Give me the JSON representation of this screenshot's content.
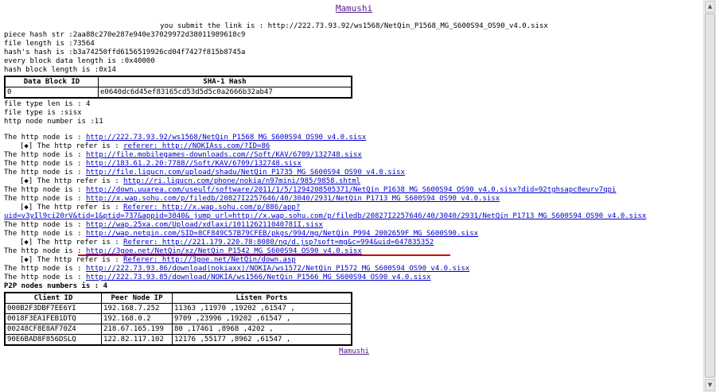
{
  "title_link": "Mamushi",
  "submit_line": "you submit the link is : http://222.73.93.92/ws1568/NetQin_P1568_MG_S600S94_OS90_v4.0.sisx",
  "info_lines": [
    "piece hash str :2aa88c270e287e940e37029972d38011989618c9",
    "file length is :73564",
    "hash's hash is :b3a74250ffd6156519926cd04f7427f815b8745a",
    "every block data length is :0x40000",
    "hash block length is :0x14"
  ],
  "block_table": {
    "headers": [
      "Data Block ID",
      "SHA-1 Hash"
    ],
    "rows": [
      [
        "0",
        "e0640dc6d45ef83165cd53d5d5c0a2666b32ab47"
      ]
    ]
  },
  "file_info": [
    "file type len is : 4",
    "file type is :sisx",
    "http node number is :11"
  ],
  "node_prefix": "The http node is : ",
  "refer_prefix": "[◆] The http refer is : ",
  "nodes": [
    {
      "url": "http://222.73.93.92/ws1568/NetQin_P1568_MG_S600S94_OS90_v4.0.sisx",
      "refer": "referer: http://NOKIAss.com/?ID=86 "
    },
    {
      "url": "http://file.mobilegames-downloads.com//Soft/KAV/6709/132748.sisx ",
      "refer": null
    },
    {
      "url": "http://183.61.2.20:7788//Soft/KAV/6709/132748.sisx ",
      "refer": null
    },
    {
      "url": "http://file.liqucn.com/upload/shadu/NetQin_P1735_MG_S600S94_OS90_v4.0.sisx ",
      "refer": "http://ri.liqucn.com/phone/nokia/n97mini/985/9858.shtml "
    },
    {
      "url": "http://down.uuarea.com/useulf/software/2011/1/5/1294208505371/NetQin_P1638_MG_S600S94_OS90_v4.0.sisx?did=92tghsapc8eurv7qpi ",
      "refer": null
    },
    {
      "url": "http://x.wap.sohu.com/p/filedb/20827I2257646/40/3040/2931/NetQin_P1713_MG_S600S94_OS90_v4.0.sisx ",
      "refer": "Referer: http://x.wap.sohu.com/p/886/app?",
      "refer_cont": "uid=v3yIl9ci20rV&tid=1&ptid=737&appid=3040&_jump_url=http://x.wap.sohu.com/p/filedb/20827I2257646/40/3040/2931/NetQin_P1713_MG_S600S94_OS90_v4.0.sisx "
    },
    {
      "url": "http://wap.25xa.com/Upload/xdlaxi/101126211040781I.sisx ",
      "refer": null
    },
    {
      "url": "http://wap.netqin.com/SID=8CF849C57B79CFEB/pkgs/994/mg/NetQin_P994_2002659F_MG_S600S90.sisx ",
      "refer": "Referer: http://221.179.220.78:8080/nq/d.jsp?soft=mg&c=994&uid=647835352 "
    },
    {
      "url": "http://3goe.net/NetQin/xz/NetQin_P1542_MG_S600S94_OS90_v4.0.sisx ",
      "refer": "Referer: http://3goe.net/NetQin/down.asp "
    },
    {
      "url": "http://222.73.93.86/download(nokiaxx)/NOKIA/ws1572/NetQin_P1572_MG_S600S94_OS90_v4.0.sisx ",
      "refer": null
    },
    {
      "url": "http://222.73.93.85/download/NOKIA/ws1566/NetQin_P1566_MG_S600S94_OS90_v4.0.sisx ",
      "refer": null
    }
  ],
  "p2p_heading": "P2P nodes numbers is : 4",
  "p2p_table": {
    "headers": [
      "Client ID",
      "Peer Node IP",
      "Listen Ports"
    ],
    "rows": [
      [
        "000B2F3DBF7EE6YI",
        "192.168.7.252",
        "11363 ,11970 ,19202 ,61547 ,"
      ],
      [
        "0018F3EA1FEB1DTQ",
        "192.168.0.2",
        "9709 ,23996 ,19202 ,61547 ,"
      ],
      [
        "00248CF8E8AF70Z4",
        "218.67.165.199",
        "80 ,17461 ,8968 ,4202 ,"
      ],
      [
        "90E6BAD8F856DSLQ",
        "122.82.117.102",
        "12176 ,55177 ,8962 ,61547 ,"
      ]
    ]
  },
  "footer_link": "Mamushi"
}
